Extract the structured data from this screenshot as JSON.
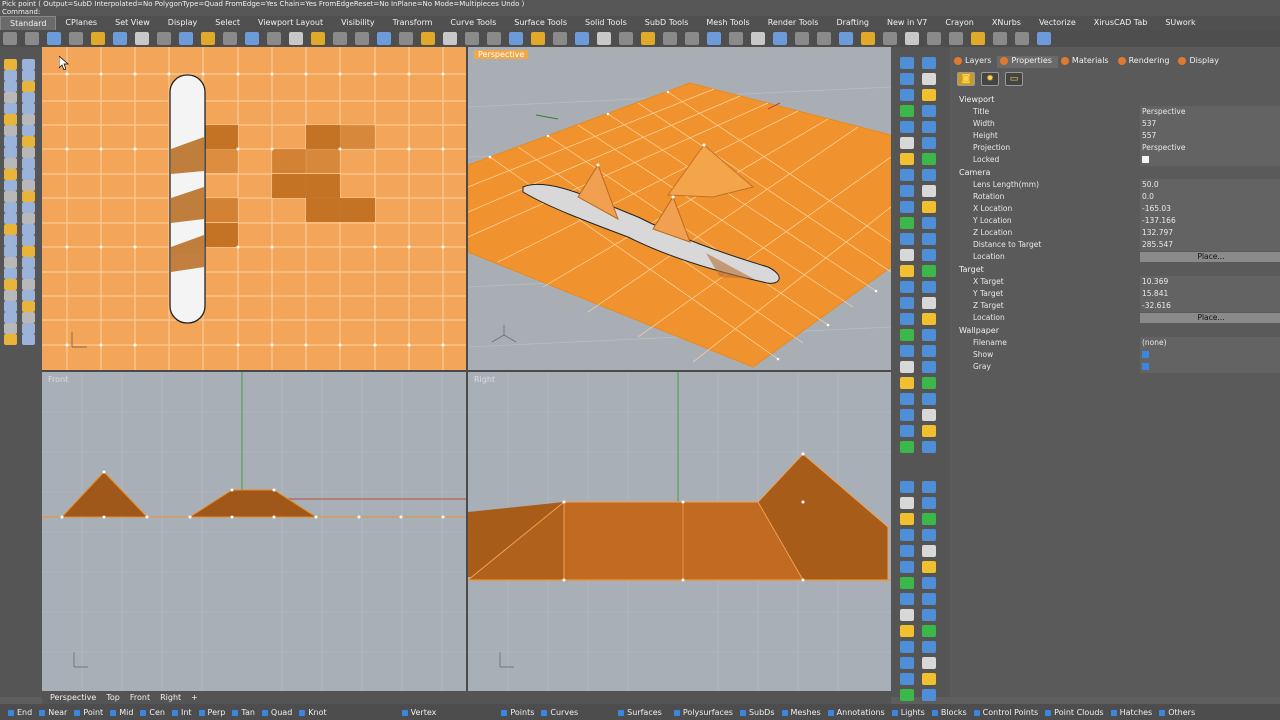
{
  "command": {
    "prompt": "Pick point ( Output=SubD  Interpolated=No  PolygonType=Quad  FromEdge=Yes  Chain=Yes  FromEdgeReset=No  InPlane=No  Mode=Multipieces  Undo )",
    "label": "Command:"
  },
  "tabs": [
    "Standard",
    "CPlanes",
    "Set View",
    "Display",
    "Select",
    "Viewport Layout",
    "Visibility",
    "Transform",
    "Curve Tools",
    "Surface Tools",
    "Solid Tools",
    "SubD Tools",
    "Mesh Tools",
    "Render Tools",
    "Drafting",
    "New in V7",
    "Crayon",
    "XNurbs",
    "Vectorize",
    "XirusCAD Tab",
    "SUwork"
  ],
  "viewports": {
    "top": {
      "label": ""
    },
    "perspective": {
      "label": "Perspective"
    },
    "front": {
      "label": "Front"
    },
    "right": {
      "label": "Right"
    }
  },
  "viewport_tabs": [
    "Perspective",
    "Top",
    "Front",
    "Right",
    "+"
  ],
  "panel": {
    "tabs": [
      "Layers",
      "Properties",
      "Materials",
      "Rendering",
      "Display"
    ],
    "active_tab": "Properties",
    "sections": [
      {
        "title": "Viewport",
        "rows": [
          {
            "k": "Title",
            "v": "Perspective"
          },
          {
            "k": "Width",
            "v": "537"
          },
          {
            "k": "Height",
            "v": "557"
          },
          {
            "k": "Projection",
            "v": "Perspective"
          },
          {
            "k": "Locked",
            "v": "",
            "checkbox": "off"
          }
        ]
      },
      {
        "title": "Camera",
        "rows": [
          {
            "k": "Lens Length(mm)",
            "v": "50.0"
          },
          {
            "k": "Rotation",
            "v": "0.0"
          },
          {
            "k": "X Location",
            "v": "-165.03"
          },
          {
            "k": "Y Location",
            "v": "-137.166"
          },
          {
            "k": "Z Location",
            "v": "132.797"
          },
          {
            "k": "Distance to Target",
            "v": "285.547"
          },
          {
            "k": "Location",
            "v": "Place...",
            "button": true
          }
        ]
      },
      {
        "title": "Target",
        "rows": [
          {
            "k": "X Target",
            "v": "10.369"
          },
          {
            "k": "Y Target",
            "v": "15.841"
          },
          {
            "k": "Z Target",
            "v": "-32.616"
          },
          {
            "k": "Location",
            "v": "Place...",
            "button": true
          }
        ]
      },
      {
        "title": "Wallpaper",
        "rows": [
          {
            "k": "Filename",
            "v": "(none)"
          },
          {
            "k": "Show",
            "v": "",
            "checkbox": "on"
          },
          {
            "k": "Gray",
            "v": "",
            "checkbox": "on"
          }
        ]
      }
    ]
  },
  "status": [
    "End",
    "Near",
    "Point",
    "Mid",
    "Cen",
    "Int",
    "Perp",
    "Tan",
    "Quad",
    "Knot",
    "Vertex",
    "Points",
    "Curves",
    "Surfaces",
    "Polysurfaces",
    "SubDs",
    "Meshes",
    "Annotations",
    "Lights",
    "Blocks",
    "Control Points",
    "Point Clouds",
    "Hatches",
    "Others"
  ],
  "colors": {
    "accent": "#f2a84a",
    "surface": "#f3a65a",
    "dark_surface": "#b8671c",
    "grid_bg": "#a9afb6"
  }
}
